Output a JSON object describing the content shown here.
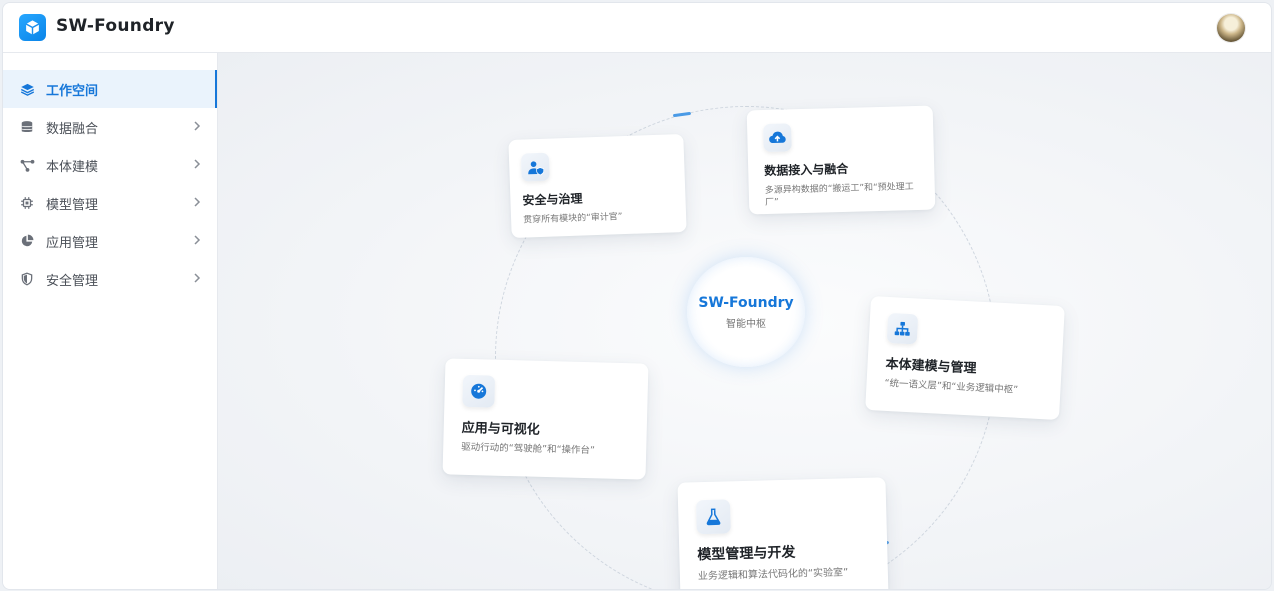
{
  "app": {
    "title": "SW-Foundry"
  },
  "sidebar": {
    "items": [
      {
        "label": "工作空间"
      },
      {
        "label": "数据融合"
      },
      {
        "label": "本体建模"
      },
      {
        "label": "模型管理"
      },
      {
        "label": "应用管理"
      },
      {
        "label": "安全管理"
      }
    ]
  },
  "hub": {
    "title": "SW-Foundry",
    "subtitle": "智能中枢"
  },
  "cards": {
    "security": {
      "title": "安全与治理",
      "desc": "贯穿所有模块的“审计官”"
    },
    "data": {
      "title": "数据接入与融合",
      "desc": "多源异构数据的“搬运工”和“预处理工厂”"
    },
    "ontology": {
      "title": "本体建模与管理",
      "desc": "“统一语义层”和“业务逻辑中枢”"
    },
    "app": {
      "title": "应用与可视化",
      "desc": "驱动行动的“驾驶舱”和“操作台”"
    },
    "model": {
      "title": "模型管理与开发",
      "desc": "业务逻辑和算法代码化的“实验室”"
    }
  },
  "colors": {
    "accent": "#1677d9",
    "active_bg": "#eaf3fc"
  },
  "icons": [
    "cube-logo-icon",
    "layers-icon",
    "database-icon",
    "graph-icon",
    "chip-icon",
    "pie-chart-icon",
    "shield-icon",
    "user-shield-icon",
    "cloud-upload-icon",
    "hierarchy-icon",
    "dashboard-icon",
    "flask-icon"
  ]
}
